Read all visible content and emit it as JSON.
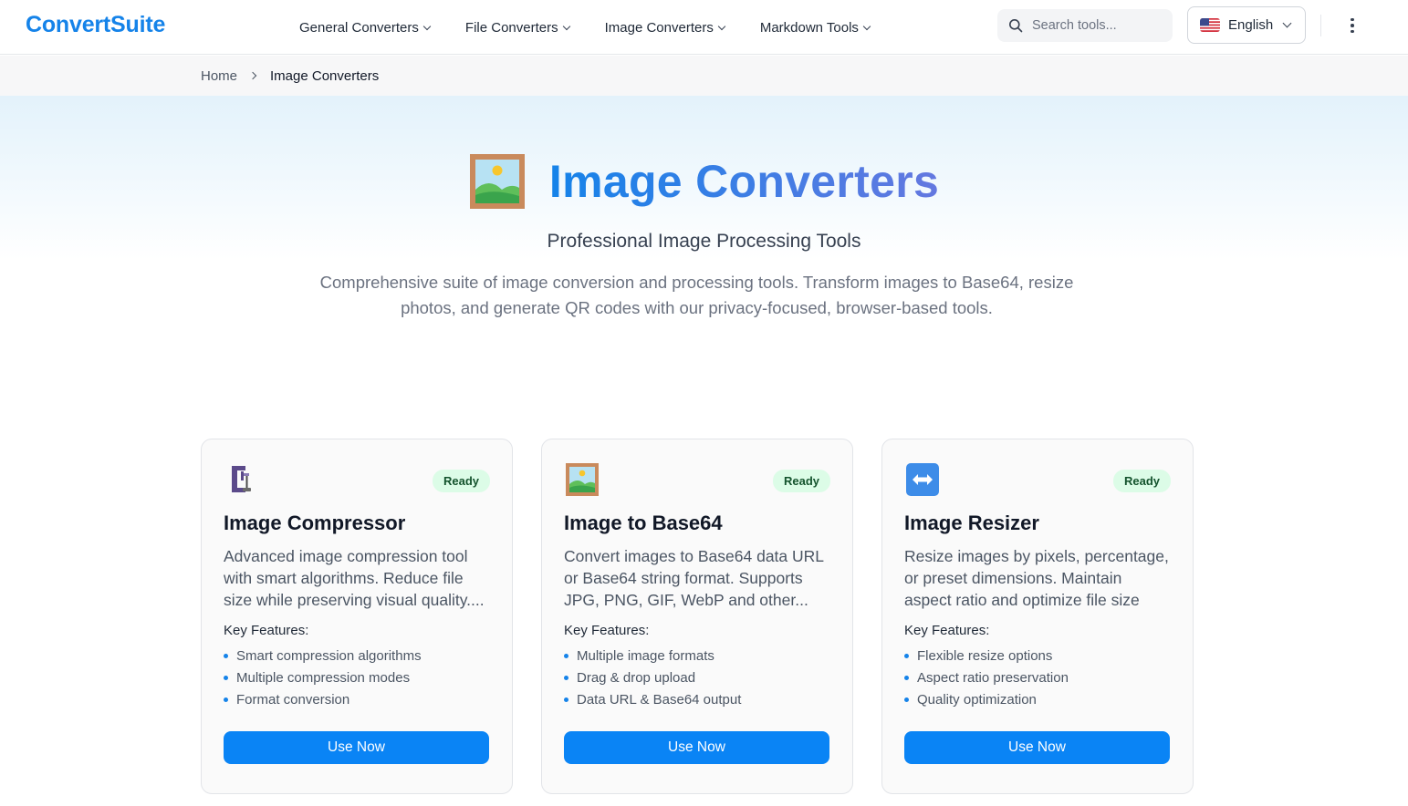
{
  "header": {
    "logo": "ConvertSuite",
    "nav": [
      {
        "label": "General Converters"
      },
      {
        "label": "File Converters"
      },
      {
        "label": "Image Converters"
      },
      {
        "label": "Markdown Tools"
      }
    ],
    "search_placeholder": "Search tools...",
    "language": "English"
  },
  "breadcrumb": {
    "home": "Home",
    "current": "Image Converters"
  },
  "hero": {
    "title": "Image Converters",
    "subtitle": "Professional Image Processing Tools",
    "description": "Comprehensive suite of image conversion and processing tools. Transform images to Base64, resize photos, and generate QR codes with our privacy-focused, browser-based tools."
  },
  "cards": [
    {
      "icon": "clamp-icon",
      "badge": "Ready",
      "title": "Image Compressor",
      "description": "Advanced image compression tool with smart algorithms. Reduce file size while preserving visual quality....",
      "features_label": "Key Features:",
      "features": [
        "Smart compression algorithms",
        "Multiple compression modes",
        "Format conversion"
      ],
      "button": "Use Now"
    },
    {
      "icon": "framed-picture-icon",
      "badge": "Ready",
      "title": "Image to Base64",
      "description": "Convert images to Base64 data URL or Base64 string format. Supports JPG, PNG, GIF, WebP and other...",
      "features_label": "Key Features:",
      "features": [
        "Multiple image formats",
        "Drag & drop upload",
        "Data URL & Base64 output"
      ],
      "button": "Use Now"
    },
    {
      "icon": "left-right-arrow-icon",
      "badge": "Ready",
      "title": "Image Resizer",
      "description": "Resize images by pixels, percentage, or preset dimensions. Maintain aspect ratio and optimize file size while...",
      "features_label": "Key Features:",
      "features": [
        "Flexible resize options",
        "Aspect ratio preservation",
        "Quality optimization"
      ],
      "button": "Use Now"
    }
  ],
  "colors": {
    "brand": "#1583e9",
    "button": "#0a84f5",
    "badge_bg": "#dcfce7",
    "badge_text": "#14532d"
  }
}
